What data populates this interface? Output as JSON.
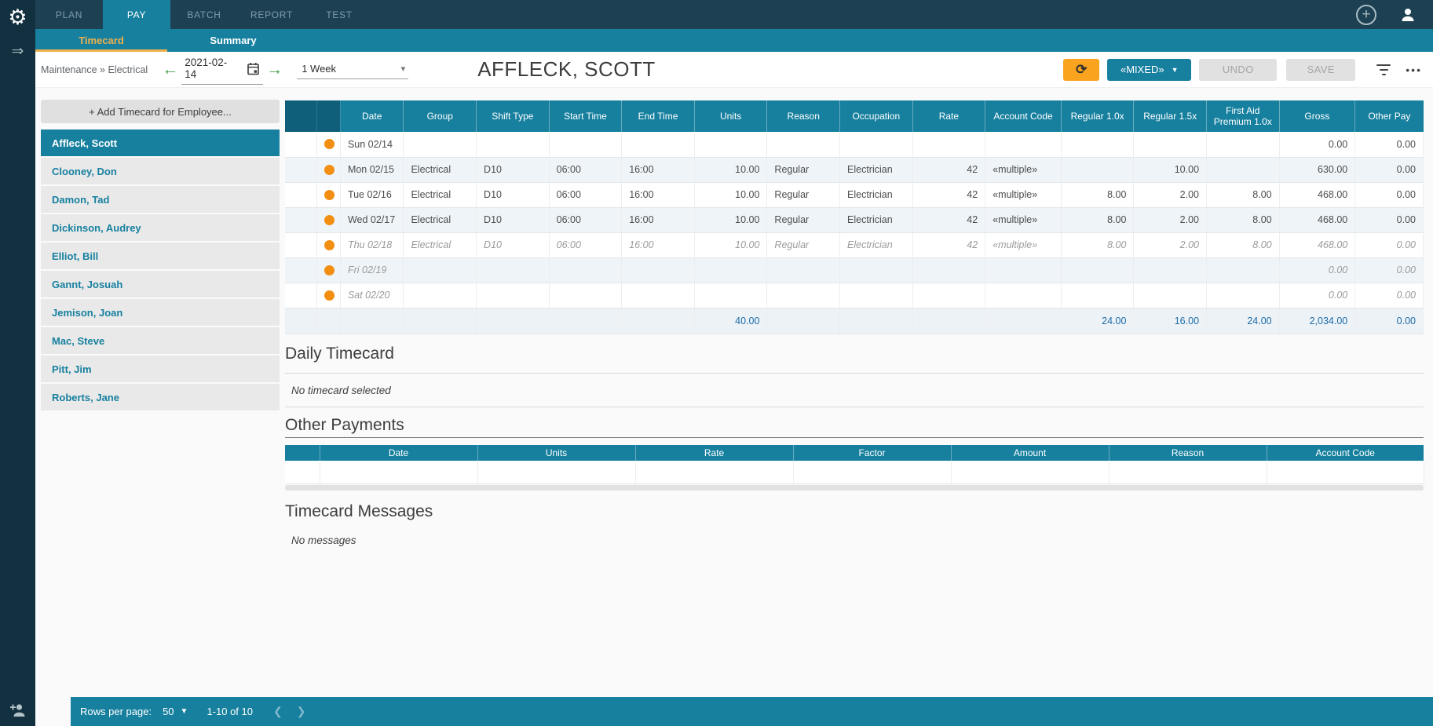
{
  "colors": {
    "brand_teal": "#17809f",
    "nav_dark": "#1d4153",
    "rail_dark": "#12303f",
    "accent_orange": "#f9a31e",
    "tab_highlight_orange": "#efb14c",
    "status_dot_orange": "#f28f13",
    "totals_text_blue": "#1b6ca8",
    "row_alt": "#eff4f8"
  },
  "icons": {
    "logo": "⚙",
    "expand": "⇒",
    "add_circle_plus": "+",
    "refresh": "⟳",
    "mixed_caret": "▼",
    "more": "•••",
    "back_arrow": "←",
    "forward_arrow": "→",
    "period_caret": "▾",
    "rows_caret": "▼",
    "prev_page": "❮",
    "next_page": "❯"
  },
  "nav": {
    "tabs": [
      {
        "label": "PLAN",
        "active": false
      },
      {
        "label": "PAY",
        "active": true
      },
      {
        "label": "BATCH",
        "active": false
      },
      {
        "label": "REPORT",
        "active": false
      },
      {
        "label": "TEST",
        "active": false
      }
    ],
    "sub_tabs": [
      {
        "label": "Timecard",
        "active": true
      },
      {
        "label": "Summary",
        "active": false
      }
    ]
  },
  "toolbar": {
    "breadcrumb": "Maintenance » Electrical",
    "date_value": "2021-02-14",
    "period_value": "1 Week",
    "employee_title": "AFFLECK, SCOTT",
    "mixed_button": "«MIXED»",
    "undo_button": "UNDO",
    "save_button": "SAVE"
  },
  "employee_panel": {
    "add_button": "+ Add Timecard for Employee...",
    "employees": [
      {
        "name": "Affleck, Scott",
        "selected": true
      },
      {
        "name": "Clooney, Don",
        "selected": false
      },
      {
        "name": "Damon, Tad",
        "selected": false
      },
      {
        "name": "Dickinson, Audrey",
        "selected": false
      },
      {
        "name": "Elliot, Bill",
        "selected": false
      },
      {
        "name": "Gannt, Josuah",
        "selected": false
      },
      {
        "name": "Jemison, Joan",
        "selected": false
      },
      {
        "name": "Mac, Steve",
        "selected": false
      },
      {
        "name": "Pitt, Jim",
        "selected": false
      },
      {
        "name": "Roberts, Jane",
        "selected": false
      }
    ]
  },
  "timecard_table": {
    "columns": [
      "",
      "",
      "Date",
      "Group",
      "Shift Type",
      "Start Time",
      "End Time",
      "Units",
      "Reason",
      "Occupation",
      "Rate",
      "Account Code",
      "Regular 1.0x",
      "Regular 1.5x",
      "First Aid Premium 1.0x",
      "Gross",
      "Other Pay"
    ],
    "rows": [
      {
        "date": "Sun 02/14",
        "group": "",
        "shift_type": "",
        "start_time": "",
        "end_time": "",
        "units": "",
        "reason": "",
        "occupation": "",
        "rate": "",
        "account_code": "",
        "regular_1_0x": "",
        "regular_1_5x": "",
        "first_aid_premium": "",
        "gross": "0.00",
        "other_pay": "0.00",
        "pending": false
      },
      {
        "date": "Mon 02/15",
        "group": "Electrical",
        "shift_type": "D10",
        "start_time": "06:00",
        "end_time": "16:00",
        "units": "10.00",
        "reason": "Regular",
        "occupation": "Electrician",
        "rate": "42",
        "account_code": "«multiple»",
        "regular_1_0x": "",
        "regular_1_5x": "10.00",
        "first_aid_premium": "",
        "gross": "630.00",
        "other_pay": "0.00",
        "pending": false
      },
      {
        "date": "Tue 02/16",
        "group": "Electrical",
        "shift_type": "D10",
        "start_time": "06:00",
        "end_time": "16:00",
        "units": "10.00",
        "reason": "Regular",
        "occupation": "Electrician",
        "rate": "42",
        "account_code": "«multiple»",
        "regular_1_0x": "8.00",
        "regular_1_5x": "2.00",
        "first_aid_premium": "8.00",
        "gross": "468.00",
        "other_pay": "0.00",
        "pending": false
      },
      {
        "date": "Wed 02/17",
        "group": "Electrical",
        "shift_type": "D10",
        "start_time": "06:00",
        "end_time": "16:00",
        "units": "10.00",
        "reason": "Regular",
        "occupation": "Electrician",
        "rate": "42",
        "account_code": "«multiple»",
        "regular_1_0x": "8.00",
        "regular_1_5x": "2.00",
        "first_aid_premium": "8.00",
        "gross": "468.00",
        "other_pay": "0.00",
        "pending": false
      },
      {
        "date": "Thu 02/18",
        "group": "Electrical",
        "shift_type": "D10",
        "start_time": "06:00",
        "end_time": "16:00",
        "units": "10.00",
        "reason": "Regular",
        "occupation": "Electrician",
        "rate": "42",
        "account_code": "«multiple»",
        "regular_1_0x": "8.00",
        "regular_1_5x": "2.00",
        "first_aid_premium": "8.00",
        "gross": "468.00",
        "other_pay": "0.00",
        "pending": true
      },
      {
        "date": "Fri 02/19",
        "group": "",
        "shift_type": "",
        "start_time": "",
        "end_time": "",
        "units": "",
        "reason": "",
        "occupation": "",
        "rate": "",
        "account_code": "",
        "regular_1_0x": "",
        "regular_1_5x": "",
        "first_aid_premium": "",
        "gross": "0.00",
        "other_pay": "0.00",
        "pending": true
      },
      {
        "date": "Sat 02/20",
        "group": "",
        "shift_type": "",
        "start_time": "",
        "end_time": "",
        "units": "",
        "reason": "",
        "occupation": "",
        "rate": "",
        "account_code": "",
        "regular_1_0x": "",
        "regular_1_5x": "",
        "first_aid_premium": "",
        "gross": "0.00",
        "other_pay": "0.00",
        "pending": true
      }
    ],
    "totals": {
      "units": "40.00",
      "regular_1_0x": "24.00",
      "regular_1_5x": "16.00",
      "first_aid_premium": "24.00",
      "gross": "2,034.00",
      "other_pay": "0.00"
    }
  },
  "daily_timecard": {
    "title": "Daily Timecard",
    "empty_message": "No timecard selected"
  },
  "other_payments": {
    "title": "Other Payments",
    "columns": [
      "",
      "Date",
      "Units",
      "Rate",
      "Factor",
      "Amount",
      "Reason",
      "Account Code"
    ]
  },
  "timecard_messages": {
    "title": "Timecard Messages",
    "empty_message": "No messages"
  },
  "footer": {
    "rows_per_page_label": "Rows per page:",
    "rows_per_page_value": "50",
    "range_label": "1-10 of 10"
  }
}
